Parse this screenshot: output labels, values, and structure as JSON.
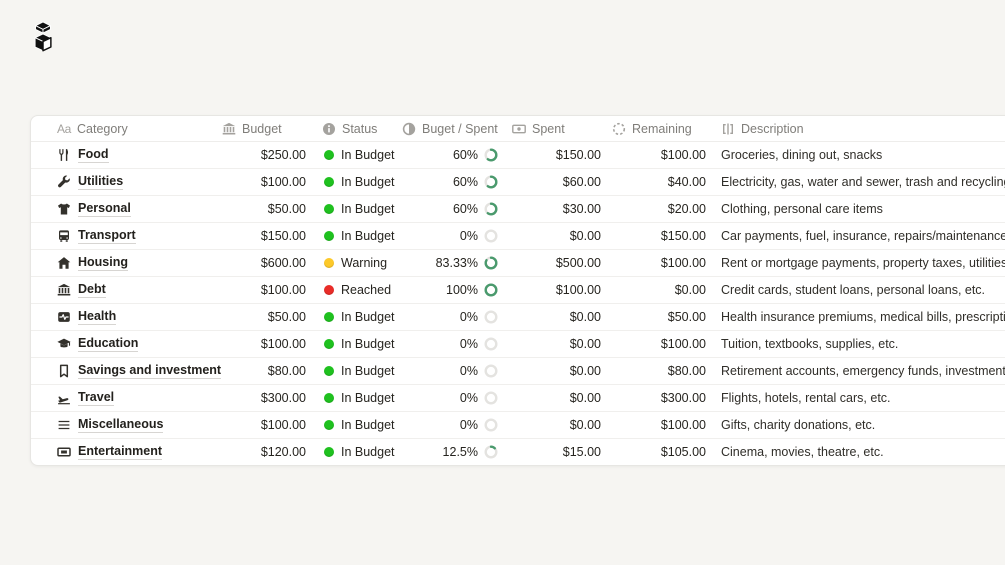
{
  "page": {
    "background": "#f6f5f2"
  },
  "logo": {
    "icon": "stacked-boxes"
  },
  "table": {
    "columns": [
      {
        "key": "category",
        "label": "Category",
        "icon": "text-aa"
      },
      {
        "key": "budget",
        "label": "Budget",
        "icon": "bank"
      },
      {
        "key": "status",
        "label": "Status",
        "icon": "info"
      },
      {
        "key": "budget_spent",
        "label": "Buget / Spent",
        "icon": "half-circle"
      },
      {
        "key": "spent",
        "label": "Spent",
        "icon": "banknote"
      },
      {
        "key": "remaining",
        "label": "Remaining",
        "icon": "dashed-circle"
      },
      {
        "key": "description",
        "label": "Description",
        "icon": "formula-brackets"
      }
    ],
    "status_colors": {
      "green": "#1fc11f",
      "yellow": "#fdc929",
      "red": "#e92c28"
    },
    "ring": {
      "progress_color": "#4a9a6d",
      "track_color": "#e4e3e0"
    },
    "rows": [
      {
        "icon": "fork-knife",
        "category": "Food",
        "budget": "$250.00",
        "status": "In Budget",
        "status_color": "green",
        "percent": "60%",
        "percent_value": 60,
        "spent": "$150.00",
        "remaining": "$100.00",
        "description": "Groceries, dining out, snacks"
      },
      {
        "icon": "wrench",
        "category": "Utilities",
        "budget": "$100.00",
        "status": "In Budget",
        "status_color": "green",
        "percent": "60%",
        "percent_value": 60,
        "spent": "$60.00",
        "remaining": "$40.00",
        "description": "Electricity, gas, water and sewer, trash and recycling, internet, etc."
      },
      {
        "icon": "tshirt",
        "category": "Personal",
        "budget": "$50.00",
        "status": "In Budget",
        "status_color": "green",
        "percent": "60%",
        "percent_value": 60,
        "spent": "$30.00",
        "remaining": "$20.00",
        "description": "Clothing, personal care items"
      },
      {
        "icon": "bus",
        "category": "Transport",
        "budget": "$150.00",
        "status": "In Budget",
        "status_color": "green",
        "percent": "0%",
        "percent_value": 0,
        "spent": "$0.00",
        "remaining": "$150.00",
        "description": "Car payments, fuel, insurance, repairs/maintenance, public transport, etc."
      },
      {
        "icon": "house",
        "category": "Housing",
        "budget": "$600.00",
        "status": "Warning",
        "status_color": "yellow",
        "percent": "83.33%",
        "percent_value": 83.33,
        "spent": "$500.00",
        "remaining": "$100.00",
        "description": "Rent or mortgage payments, property taxes, utilities, home insurance, etc."
      },
      {
        "icon": "bank",
        "category": "Debt",
        "budget": "$100.00",
        "status": "Reached",
        "status_color": "red",
        "percent": "100%",
        "percent_value": 100,
        "spent": "$100.00",
        "remaining": "$0.00",
        "description": "Credit cards, student loans, personal loans, etc."
      },
      {
        "icon": "activity",
        "category": "Health",
        "budget": "$50.00",
        "status": "In Budget",
        "status_color": "green",
        "percent": "0%",
        "percent_value": 0,
        "spent": "$0.00",
        "remaining": "$50.00",
        "description": "Health insurance premiums, medical bills, prescriptions, etc."
      },
      {
        "icon": "graduation-cap",
        "category": "Education",
        "budget": "$100.00",
        "status": "In Budget",
        "status_color": "green",
        "percent": "0%",
        "percent_value": 0,
        "spent": "$0.00",
        "remaining": "$100.00",
        "description": "Tuition, textbooks, supplies, etc."
      },
      {
        "icon": "bookmark",
        "category": "Savings and investment",
        "budget": "$80.00",
        "status": "In Budget",
        "status_color": "green",
        "percent": "0%",
        "percent_value": 0,
        "spent": "$0.00",
        "remaining": "$80.00",
        "description": "Retirement accounts, emergency funds, investments, etc."
      },
      {
        "icon": "plane-departure",
        "category": "Travel",
        "budget": "$300.00",
        "status": "In Budget",
        "status_color": "green",
        "percent": "0%",
        "percent_value": 0,
        "spent": "$0.00",
        "remaining": "$300.00",
        "description": "Flights, hotels, rental cars, etc."
      },
      {
        "icon": "menu-lines",
        "category": "Miscellaneous",
        "budget": "$100.00",
        "status": "In Budget",
        "status_color": "green",
        "percent": "0%",
        "percent_value": 0,
        "spent": "$0.00",
        "remaining": "$100.00",
        "description": "Gifts, charity donations, etc."
      },
      {
        "icon": "cinema-screen",
        "category": "Entertainment",
        "budget": "$120.00",
        "status": "In Budget",
        "status_color": "green",
        "percent": "12.5%",
        "percent_value": 12.5,
        "spent": "$15.00",
        "remaining": "$105.00",
        "description": "Cinema, movies, theatre, etc."
      }
    ]
  }
}
